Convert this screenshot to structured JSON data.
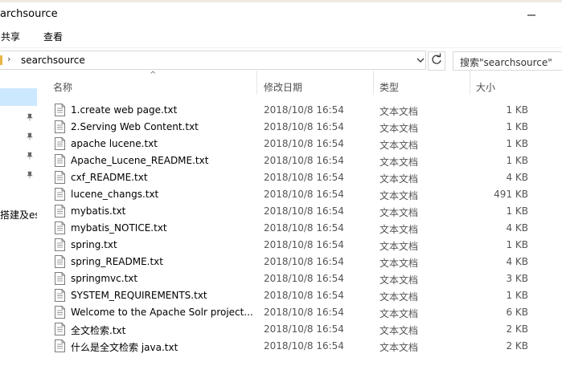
{
  "window": {
    "title": "archsource"
  },
  "ribbon": {
    "tabs": [
      "共享",
      "查看"
    ]
  },
  "address": {
    "crumb": "searchsource",
    "search_placeholder": "搜索\"searchsource\""
  },
  "nav": {
    "partial_label": "搭建及es("
  },
  "columns": {
    "name": "名称",
    "date": "修改日期",
    "type": "类型",
    "size": "大小"
  },
  "files": [
    {
      "name": "1.create web page.txt",
      "date": "2018/10/8 16:54",
      "type": "文本文档",
      "size": "1 KB"
    },
    {
      "name": "2.Serving Web Content.txt",
      "date": "2018/10/8 16:54",
      "type": "文本文档",
      "size": "1 KB"
    },
    {
      "name": "apache lucene.txt",
      "date": "2018/10/8 16:54",
      "type": "文本文档",
      "size": "1 KB"
    },
    {
      "name": "Apache_Lucene_README.txt",
      "date": "2018/10/8 16:54",
      "type": "文本文档",
      "size": "1 KB"
    },
    {
      "name": "cxf_README.txt",
      "date": "2018/10/8 16:54",
      "type": "文本文档",
      "size": "4 KB"
    },
    {
      "name": "lucene_changs.txt",
      "date": "2018/10/8 16:54",
      "type": "文本文档",
      "size": "491 KB"
    },
    {
      "name": "mybatis.txt",
      "date": "2018/10/8 16:54",
      "type": "文本文档",
      "size": "1 KB"
    },
    {
      "name": "mybatis_NOTICE.txt",
      "date": "2018/10/8 16:54",
      "type": "文本文档",
      "size": "4 KB"
    },
    {
      "name": "spring.txt",
      "date": "2018/10/8 16:54",
      "type": "文本文档",
      "size": "1 KB"
    },
    {
      "name": "spring_README.txt",
      "date": "2018/10/8 16:54",
      "type": "文本文档",
      "size": "4 KB"
    },
    {
      "name": "springmvc.txt",
      "date": "2018/10/8 16:54",
      "type": "文本文档",
      "size": "3 KB"
    },
    {
      "name": "SYSTEM_REQUIREMENTS.txt",
      "date": "2018/10/8 16:54",
      "type": "文本文档",
      "size": "1 KB"
    },
    {
      "name": "Welcome to the Apache Solr project....",
      "date": "2018/10/8 16:54",
      "type": "文本文档",
      "size": "6 KB"
    },
    {
      "name": "全文检索.txt",
      "date": "2018/10/8 16:54",
      "type": "文本文档",
      "size": "2 KB"
    },
    {
      "name": "什么是全文检索 java.txt",
      "date": "2018/10/8 16:54",
      "type": "文本文档",
      "size": "2 KB"
    }
  ],
  "colors": {
    "selection": "#cce8ff",
    "folder": "#e8b547"
  },
  "icons": [
    "minimize-icon",
    "chevron-right-icon",
    "chevron-down-icon",
    "refresh-icon",
    "pin-icon",
    "text-file-icon",
    "sort-up-icon"
  ]
}
